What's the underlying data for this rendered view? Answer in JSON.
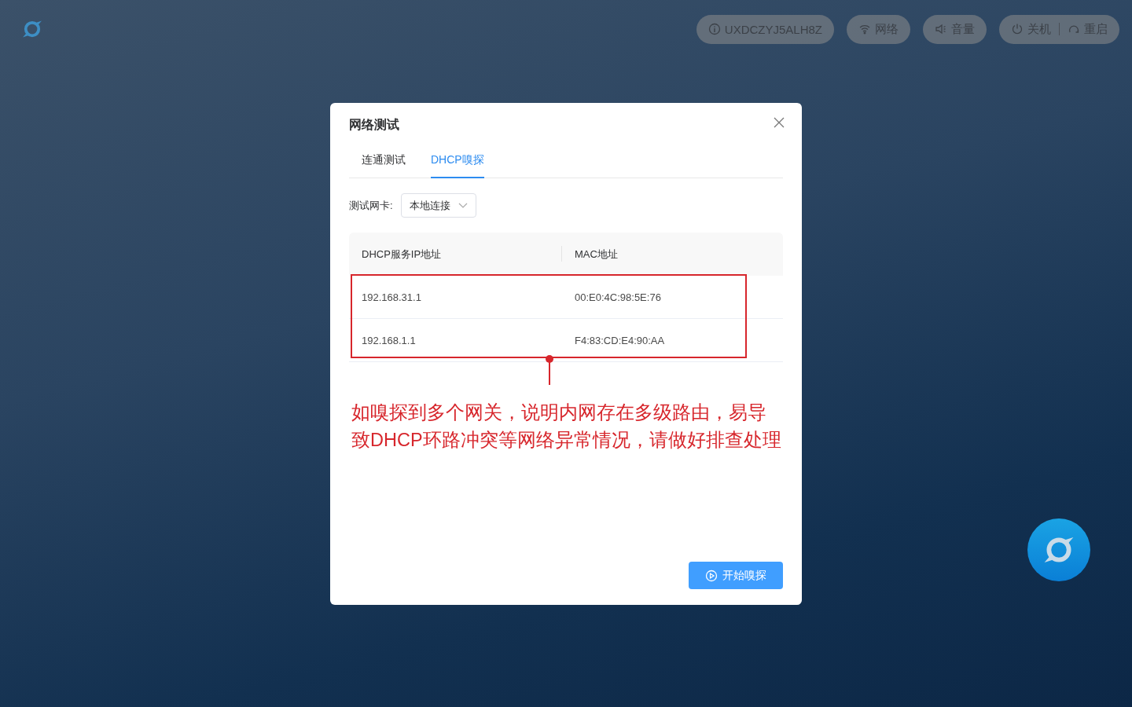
{
  "pills": [
    {
      "items": [
        {
          "kind": "info",
          "label": "UXDCZYJ5ALH8Z"
        }
      ]
    },
    {
      "items": [
        {
          "kind": "wifi",
          "label": "网络"
        }
      ]
    },
    {
      "items": [
        {
          "kind": "volume",
          "label": "音量"
        }
      ]
    },
    {
      "items": [
        {
          "kind": "power",
          "label": "关机"
        },
        {
          "kind": "restart",
          "label": "重启"
        }
      ]
    }
  ],
  "dialog": {
    "title": "网络测试",
    "tabs": [
      {
        "label": "连通测试",
        "selected": false
      },
      {
        "label": "DHCP嗅探",
        "selected": true
      }
    ],
    "adapter": {
      "label": "测试网卡:",
      "value": "本地连接"
    },
    "table": {
      "columns": [
        "DHCP服务IP地址",
        "MAC地址"
      ],
      "rows": [
        [
          "192.168.31.1",
          "00:E0:4C:98:5E:76"
        ],
        [
          "192.168.1.1",
          "F4:83:CD:E4:90:AA"
        ]
      ]
    },
    "annotation": "如嗅探到多个网关，说明内网存在多级路由，易导致DHCP环路冲突等网络异常情况，请做好排查处理",
    "start_button": "开始嗅探"
  }
}
